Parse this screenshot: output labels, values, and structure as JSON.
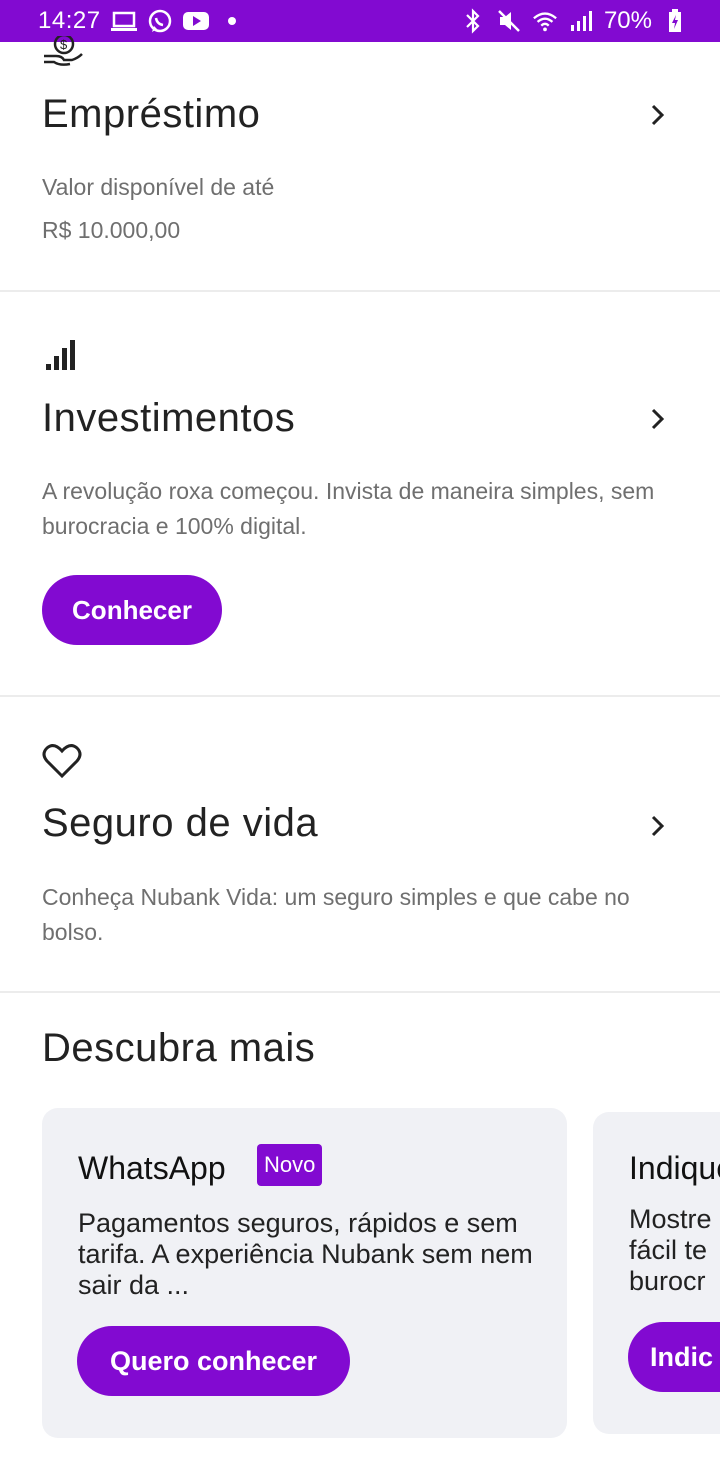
{
  "status_bar": {
    "time": "14:27",
    "battery": "70%",
    "left_icons": [
      "laptop-icon",
      "whatsapp-icon",
      "youtube-icon",
      "dot-icon"
    ],
    "right_icons": [
      "bluetooth-icon",
      "mute-icon",
      "wifi-icon",
      "signal-icon",
      "battery-charging-icon"
    ]
  },
  "loan": {
    "icon": "money-hand-icon",
    "title": "Empréstimo",
    "subtitle": "Valor disponível de até",
    "value": "R$ 10.000,00"
  },
  "investments": {
    "icon": "bar-chart-icon",
    "title": "Investimentos",
    "description": "A revolução roxa começou. Invista de maneira simples, sem burocracia e 100% digital.",
    "button_label": "Conhecer"
  },
  "life_insurance": {
    "icon": "heart-icon",
    "title": "Seguro de vida",
    "description": "Conheça Nubank Vida: um seguro simples e que cabe no bolso."
  },
  "discover": {
    "title": "Descubra mais",
    "cards": [
      {
        "title": "WhatsApp",
        "badge": "Novo",
        "description": "Pagamentos seguros, rápidos e sem tarifa. A experiência Nubank sem nem sair da ...",
        "button_label": "Quero conhecer"
      },
      {
        "title": "Indique",
        "description": "Mostre fácil te burocr",
        "button_label": "Indic"
      }
    ]
  },
  "colors": {
    "brand_purple": "#820ad1",
    "card_background": "#f0f1f5",
    "text_primary": "#222222",
    "text_secondary": "#6f6f6f"
  }
}
